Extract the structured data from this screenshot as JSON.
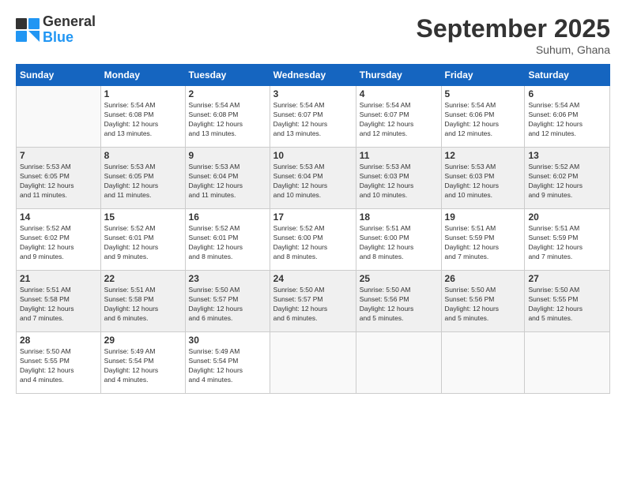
{
  "header": {
    "logo_general": "General",
    "logo_blue": "Blue",
    "month": "September 2025",
    "location": "Suhum, Ghana"
  },
  "days_of_week": [
    "Sunday",
    "Monday",
    "Tuesday",
    "Wednesday",
    "Thursday",
    "Friday",
    "Saturday"
  ],
  "weeks": [
    [
      {
        "day": "",
        "info": ""
      },
      {
        "day": "1",
        "info": "Sunrise: 5:54 AM\nSunset: 6:08 PM\nDaylight: 12 hours\nand 13 minutes."
      },
      {
        "day": "2",
        "info": "Sunrise: 5:54 AM\nSunset: 6:08 PM\nDaylight: 12 hours\nand 13 minutes."
      },
      {
        "day": "3",
        "info": "Sunrise: 5:54 AM\nSunset: 6:07 PM\nDaylight: 12 hours\nand 13 minutes."
      },
      {
        "day": "4",
        "info": "Sunrise: 5:54 AM\nSunset: 6:07 PM\nDaylight: 12 hours\nand 12 minutes."
      },
      {
        "day": "5",
        "info": "Sunrise: 5:54 AM\nSunset: 6:06 PM\nDaylight: 12 hours\nand 12 minutes."
      },
      {
        "day": "6",
        "info": "Sunrise: 5:54 AM\nSunset: 6:06 PM\nDaylight: 12 hours\nand 12 minutes."
      }
    ],
    [
      {
        "day": "7",
        "info": "Sunrise: 5:53 AM\nSunset: 6:05 PM\nDaylight: 12 hours\nand 11 minutes."
      },
      {
        "day": "8",
        "info": "Sunrise: 5:53 AM\nSunset: 6:05 PM\nDaylight: 12 hours\nand 11 minutes."
      },
      {
        "day": "9",
        "info": "Sunrise: 5:53 AM\nSunset: 6:04 PM\nDaylight: 12 hours\nand 11 minutes."
      },
      {
        "day": "10",
        "info": "Sunrise: 5:53 AM\nSunset: 6:04 PM\nDaylight: 12 hours\nand 10 minutes."
      },
      {
        "day": "11",
        "info": "Sunrise: 5:53 AM\nSunset: 6:03 PM\nDaylight: 12 hours\nand 10 minutes."
      },
      {
        "day": "12",
        "info": "Sunrise: 5:53 AM\nSunset: 6:03 PM\nDaylight: 12 hours\nand 10 minutes."
      },
      {
        "day": "13",
        "info": "Sunrise: 5:52 AM\nSunset: 6:02 PM\nDaylight: 12 hours\nand 9 minutes."
      }
    ],
    [
      {
        "day": "14",
        "info": "Sunrise: 5:52 AM\nSunset: 6:02 PM\nDaylight: 12 hours\nand 9 minutes."
      },
      {
        "day": "15",
        "info": "Sunrise: 5:52 AM\nSunset: 6:01 PM\nDaylight: 12 hours\nand 9 minutes."
      },
      {
        "day": "16",
        "info": "Sunrise: 5:52 AM\nSunset: 6:01 PM\nDaylight: 12 hours\nand 8 minutes."
      },
      {
        "day": "17",
        "info": "Sunrise: 5:52 AM\nSunset: 6:00 PM\nDaylight: 12 hours\nand 8 minutes."
      },
      {
        "day": "18",
        "info": "Sunrise: 5:51 AM\nSunset: 6:00 PM\nDaylight: 12 hours\nand 8 minutes."
      },
      {
        "day": "19",
        "info": "Sunrise: 5:51 AM\nSunset: 5:59 PM\nDaylight: 12 hours\nand 7 minutes."
      },
      {
        "day": "20",
        "info": "Sunrise: 5:51 AM\nSunset: 5:59 PM\nDaylight: 12 hours\nand 7 minutes."
      }
    ],
    [
      {
        "day": "21",
        "info": "Sunrise: 5:51 AM\nSunset: 5:58 PM\nDaylight: 12 hours\nand 7 minutes."
      },
      {
        "day": "22",
        "info": "Sunrise: 5:51 AM\nSunset: 5:58 PM\nDaylight: 12 hours\nand 6 minutes."
      },
      {
        "day": "23",
        "info": "Sunrise: 5:50 AM\nSunset: 5:57 PM\nDaylight: 12 hours\nand 6 minutes."
      },
      {
        "day": "24",
        "info": "Sunrise: 5:50 AM\nSunset: 5:57 PM\nDaylight: 12 hours\nand 6 minutes."
      },
      {
        "day": "25",
        "info": "Sunrise: 5:50 AM\nSunset: 5:56 PM\nDaylight: 12 hours\nand 5 minutes."
      },
      {
        "day": "26",
        "info": "Sunrise: 5:50 AM\nSunset: 5:56 PM\nDaylight: 12 hours\nand 5 minutes."
      },
      {
        "day": "27",
        "info": "Sunrise: 5:50 AM\nSunset: 5:55 PM\nDaylight: 12 hours\nand 5 minutes."
      }
    ],
    [
      {
        "day": "28",
        "info": "Sunrise: 5:50 AM\nSunset: 5:55 PM\nDaylight: 12 hours\nand 4 minutes."
      },
      {
        "day": "29",
        "info": "Sunrise: 5:49 AM\nSunset: 5:54 PM\nDaylight: 12 hours\nand 4 minutes."
      },
      {
        "day": "30",
        "info": "Sunrise: 5:49 AM\nSunset: 5:54 PM\nDaylight: 12 hours\nand 4 minutes."
      },
      {
        "day": "",
        "info": ""
      },
      {
        "day": "",
        "info": ""
      },
      {
        "day": "",
        "info": ""
      },
      {
        "day": "",
        "info": ""
      }
    ]
  ]
}
